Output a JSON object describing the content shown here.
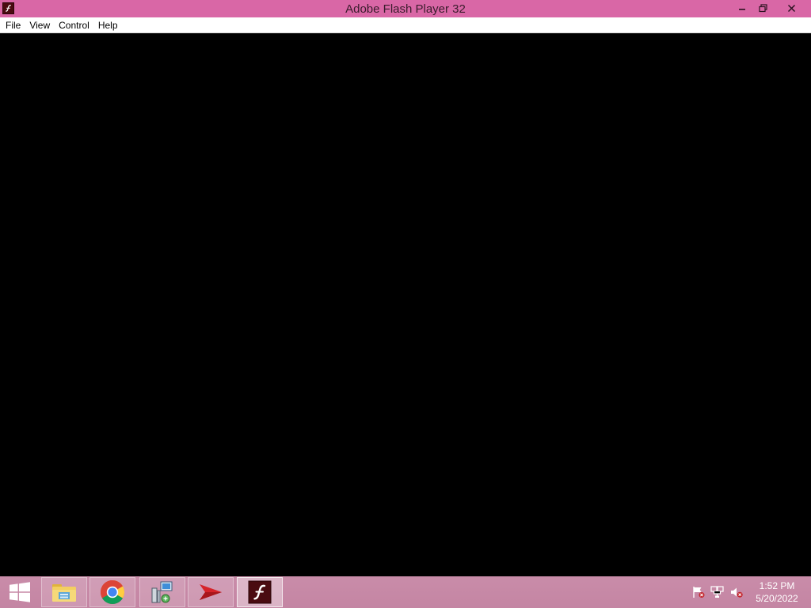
{
  "window": {
    "title": "Adobe Flash Player 32",
    "app_icon": "flash-player-icon",
    "controls": [
      "minimize-icon",
      "restore-icon",
      "close-icon"
    ]
  },
  "menu": {
    "items": [
      {
        "label": "File"
      },
      {
        "label": "View"
      },
      {
        "label": "Control"
      },
      {
        "label": "Help"
      }
    ]
  },
  "taskbar": {
    "start_icon": "windows-logo-icon",
    "pinned": [
      {
        "name": "file-explorer",
        "icon": "folder-icon"
      },
      {
        "name": "chrome",
        "icon": "chrome-icon"
      },
      {
        "name": "network-setup",
        "icon": "computer-network-icon"
      },
      {
        "name": "arrow-app",
        "icon": "red-arrow-icon"
      },
      {
        "name": "flash-player",
        "icon": "flash-player-icon",
        "active": true
      }
    ],
    "tray": {
      "icons": [
        "action-center-flag-icon",
        "network-icon",
        "volume-muted-icon"
      ],
      "time": "1:52 PM",
      "date": "5/20/2022"
    }
  },
  "colors": {
    "titlebar": "#d967a6",
    "taskbar": "#c78aa6",
    "stage": "#000000"
  }
}
